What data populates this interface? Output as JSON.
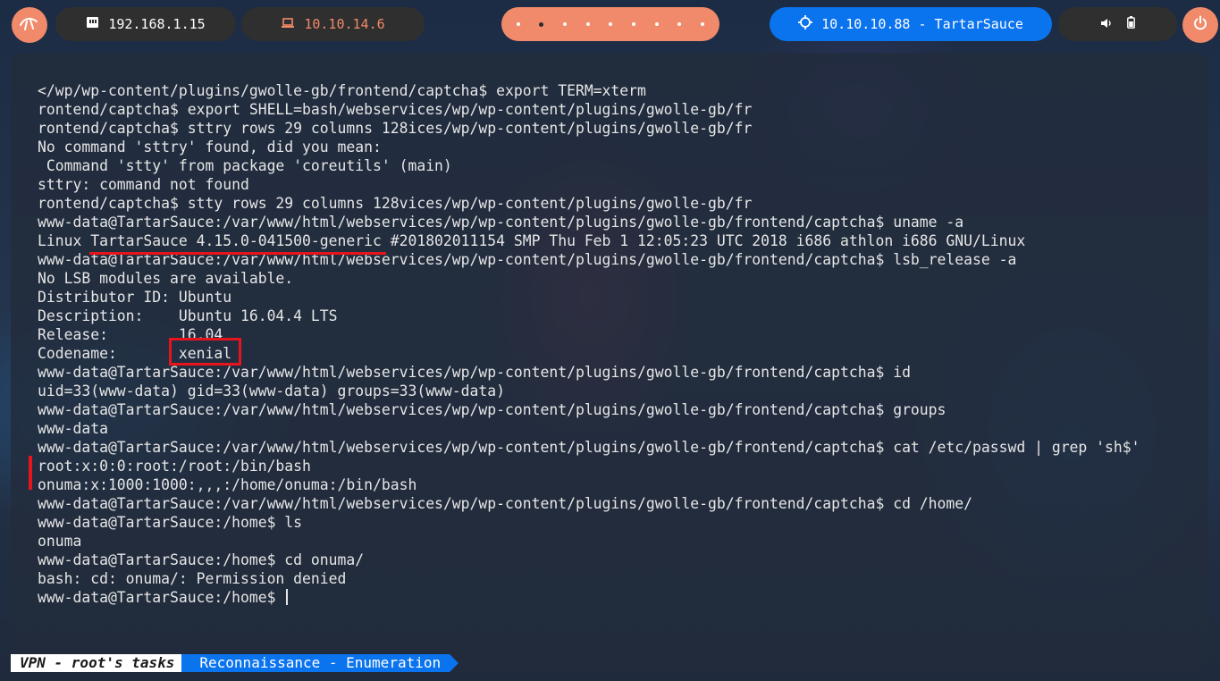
{
  "topbar": {
    "local_ip": "192.168.1.15",
    "vpn_ip": "10.10.14.6",
    "target": "10.10.10.88 - TartarSauce",
    "workspace_count": 9,
    "active_workspace": 2,
    "colors": {
      "accent": "#f08a6a",
      "target": "#0a73ee",
      "pill": "#2f2f2f"
    },
    "icons": [
      "kali-menu-icon",
      "ethernet-icon",
      "laptop-icon",
      "crosshair-icon",
      "volume-icon",
      "battery-icon",
      "power-icon"
    ]
  },
  "terminal": {
    "lines": [
      "</wp/wp-content/plugins/gwolle-gb/frontend/captcha$ export TERM=xterm",
      "rontend/captcha$ export SHELL=bash/webservices/wp/wp-content/plugins/gwolle-gb/fr",
      "rontend/captcha$ sttry rows 29 columns 128ices/wp/wp-content/plugins/gwolle-gb/fr",
      "No command 'sttry' found, did you mean:",
      " Command 'stty' from package 'coreutils' (main)",
      "sttry: command not found",
      "rontend/captcha$ stty rows 29 columns 128vices/wp/wp-content/plugins/gwolle-gb/fr",
      "www-data@TartarSauce:/var/www/html/webservices/wp/wp-content/plugins/gwolle-gb/frontend/captcha$ uname -a",
      "Linux TartarSauce 4.15.0-041500-generic #201802011154 SMP Thu Feb 1 12:05:23 UTC 2018 i686 athlon i686 GNU/Linux",
      "www-data@TartarSauce:/var/www/html/webservices/wp/wp-content/plugins/gwolle-gb/frontend/captcha$ lsb_release -a",
      "No LSB modules are available.",
      "Distributor ID: Ubuntu",
      "Description:    Ubuntu 16.04.4 LTS",
      "Release:        16.04",
      "Codename:       xenial",
      "www-data@TartarSauce:/var/www/html/webservices/wp/wp-content/plugins/gwolle-gb/frontend/captcha$ id",
      "uid=33(www-data) gid=33(www-data) groups=33(www-data)",
      "www-data@TartarSauce:/var/www/html/webservices/wp/wp-content/plugins/gwolle-gb/frontend/captcha$ groups",
      "www-data",
      "www-data@TartarSauce:/var/www/html/webservices/wp/wp-content/plugins/gwolle-gb/frontend/captcha$ cat /etc/passwd | grep 'sh$'",
      "root:x:0:0:root:/root:/bin/bash",
      "onuma:x:1000:1000:,,,:/home/onuma:/bin/bash",
      "www-data@TartarSauce:/var/www/html/webservices/wp/wp-content/plugins/gwolle-gb/frontend/captcha$ cd /home/",
      "www-data@TartarSauce:/home$ ls",
      "onuma",
      "www-data@TartarSauce:/home$ cd onuma/",
      "bash: cd: onuma/: Permission denied",
      "www-data@TartarSauce:/home$ "
    ],
    "highlight_color": "#e8141c"
  },
  "statusbar": {
    "session": "VPN - root's tasks",
    "window": "Reconnaissance - Enumeration"
  }
}
